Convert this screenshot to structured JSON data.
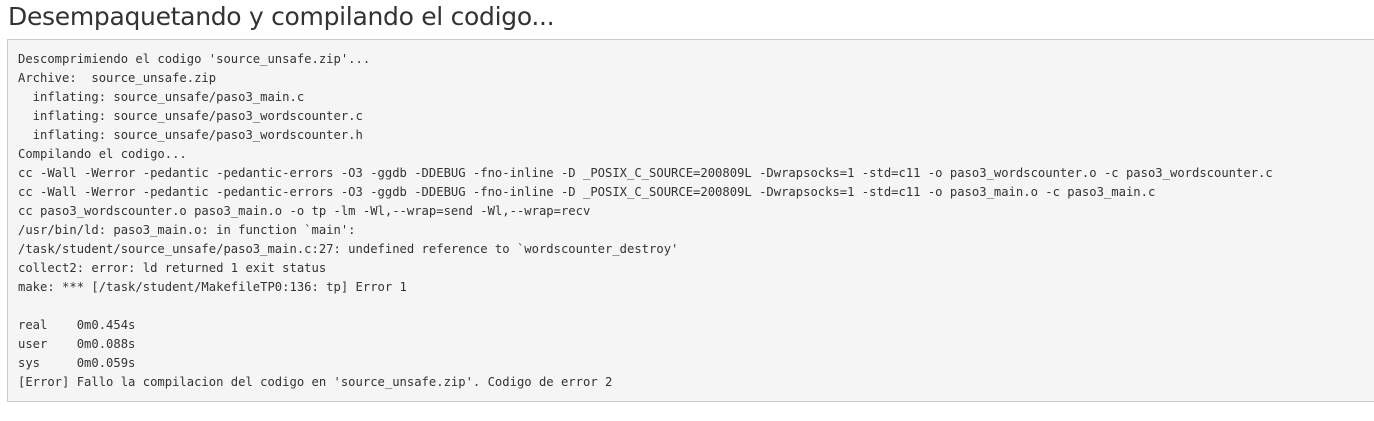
{
  "page": {
    "title": "Desempaquetando y compilando el codigo..."
  },
  "output": {
    "lines": [
      "Descomprimiendo el codigo 'source_unsafe.zip'...",
      "Archive:  source_unsafe.zip",
      "  inflating: source_unsafe/paso3_main.c",
      "  inflating: source_unsafe/paso3_wordscounter.c",
      "  inflating: source_unsafe/paso3_wordscounter.h",
      "Compilando el codigo...",
      "cc -Wall -Werror -pedantic -pedantic-errors -O3 -ggdb -DDEBUG -fno-inline -D _POSIX_C_SOURCE=200809L -Dwrapsocks=1 -std=c11 -o paso3_wordscounter.o -c paso3_wordscounter.c",
      "cc -Wall -Werror -pedantic -pedantic-errors -O3 -ggdb -DDEBUG -fno-inline -D _POSIX_C_SOURCE=200809L -Dwrapsocks=1 -std=c11 -o paso3_main.o -c paso3_main.c",
      "cc paso3_wordscounter.o paso3_main.o -o tp -lm -Wl,--wrap=send -Wl,--wrap=recv",
      "/usr/bin/ld: paso3_main.o: in function `main':",
      "/task/student/source_unsafe/paso3_main.c:27: undefined reference to `wordscounter_destroy'",
      "collect2: error: ld returned 1 exit status",
      "make: *** [/task/student/MakefileTP0:136: tp] Error 1",
      "",
      "real    0m0.454s",
      "user    0m0.088s",
      "sys     0m0.059s",
      "[Error] Fallo la compilacion del codigo en 'source_unsafe.zip'. Codigo de error 2"
    ]
  }
}
